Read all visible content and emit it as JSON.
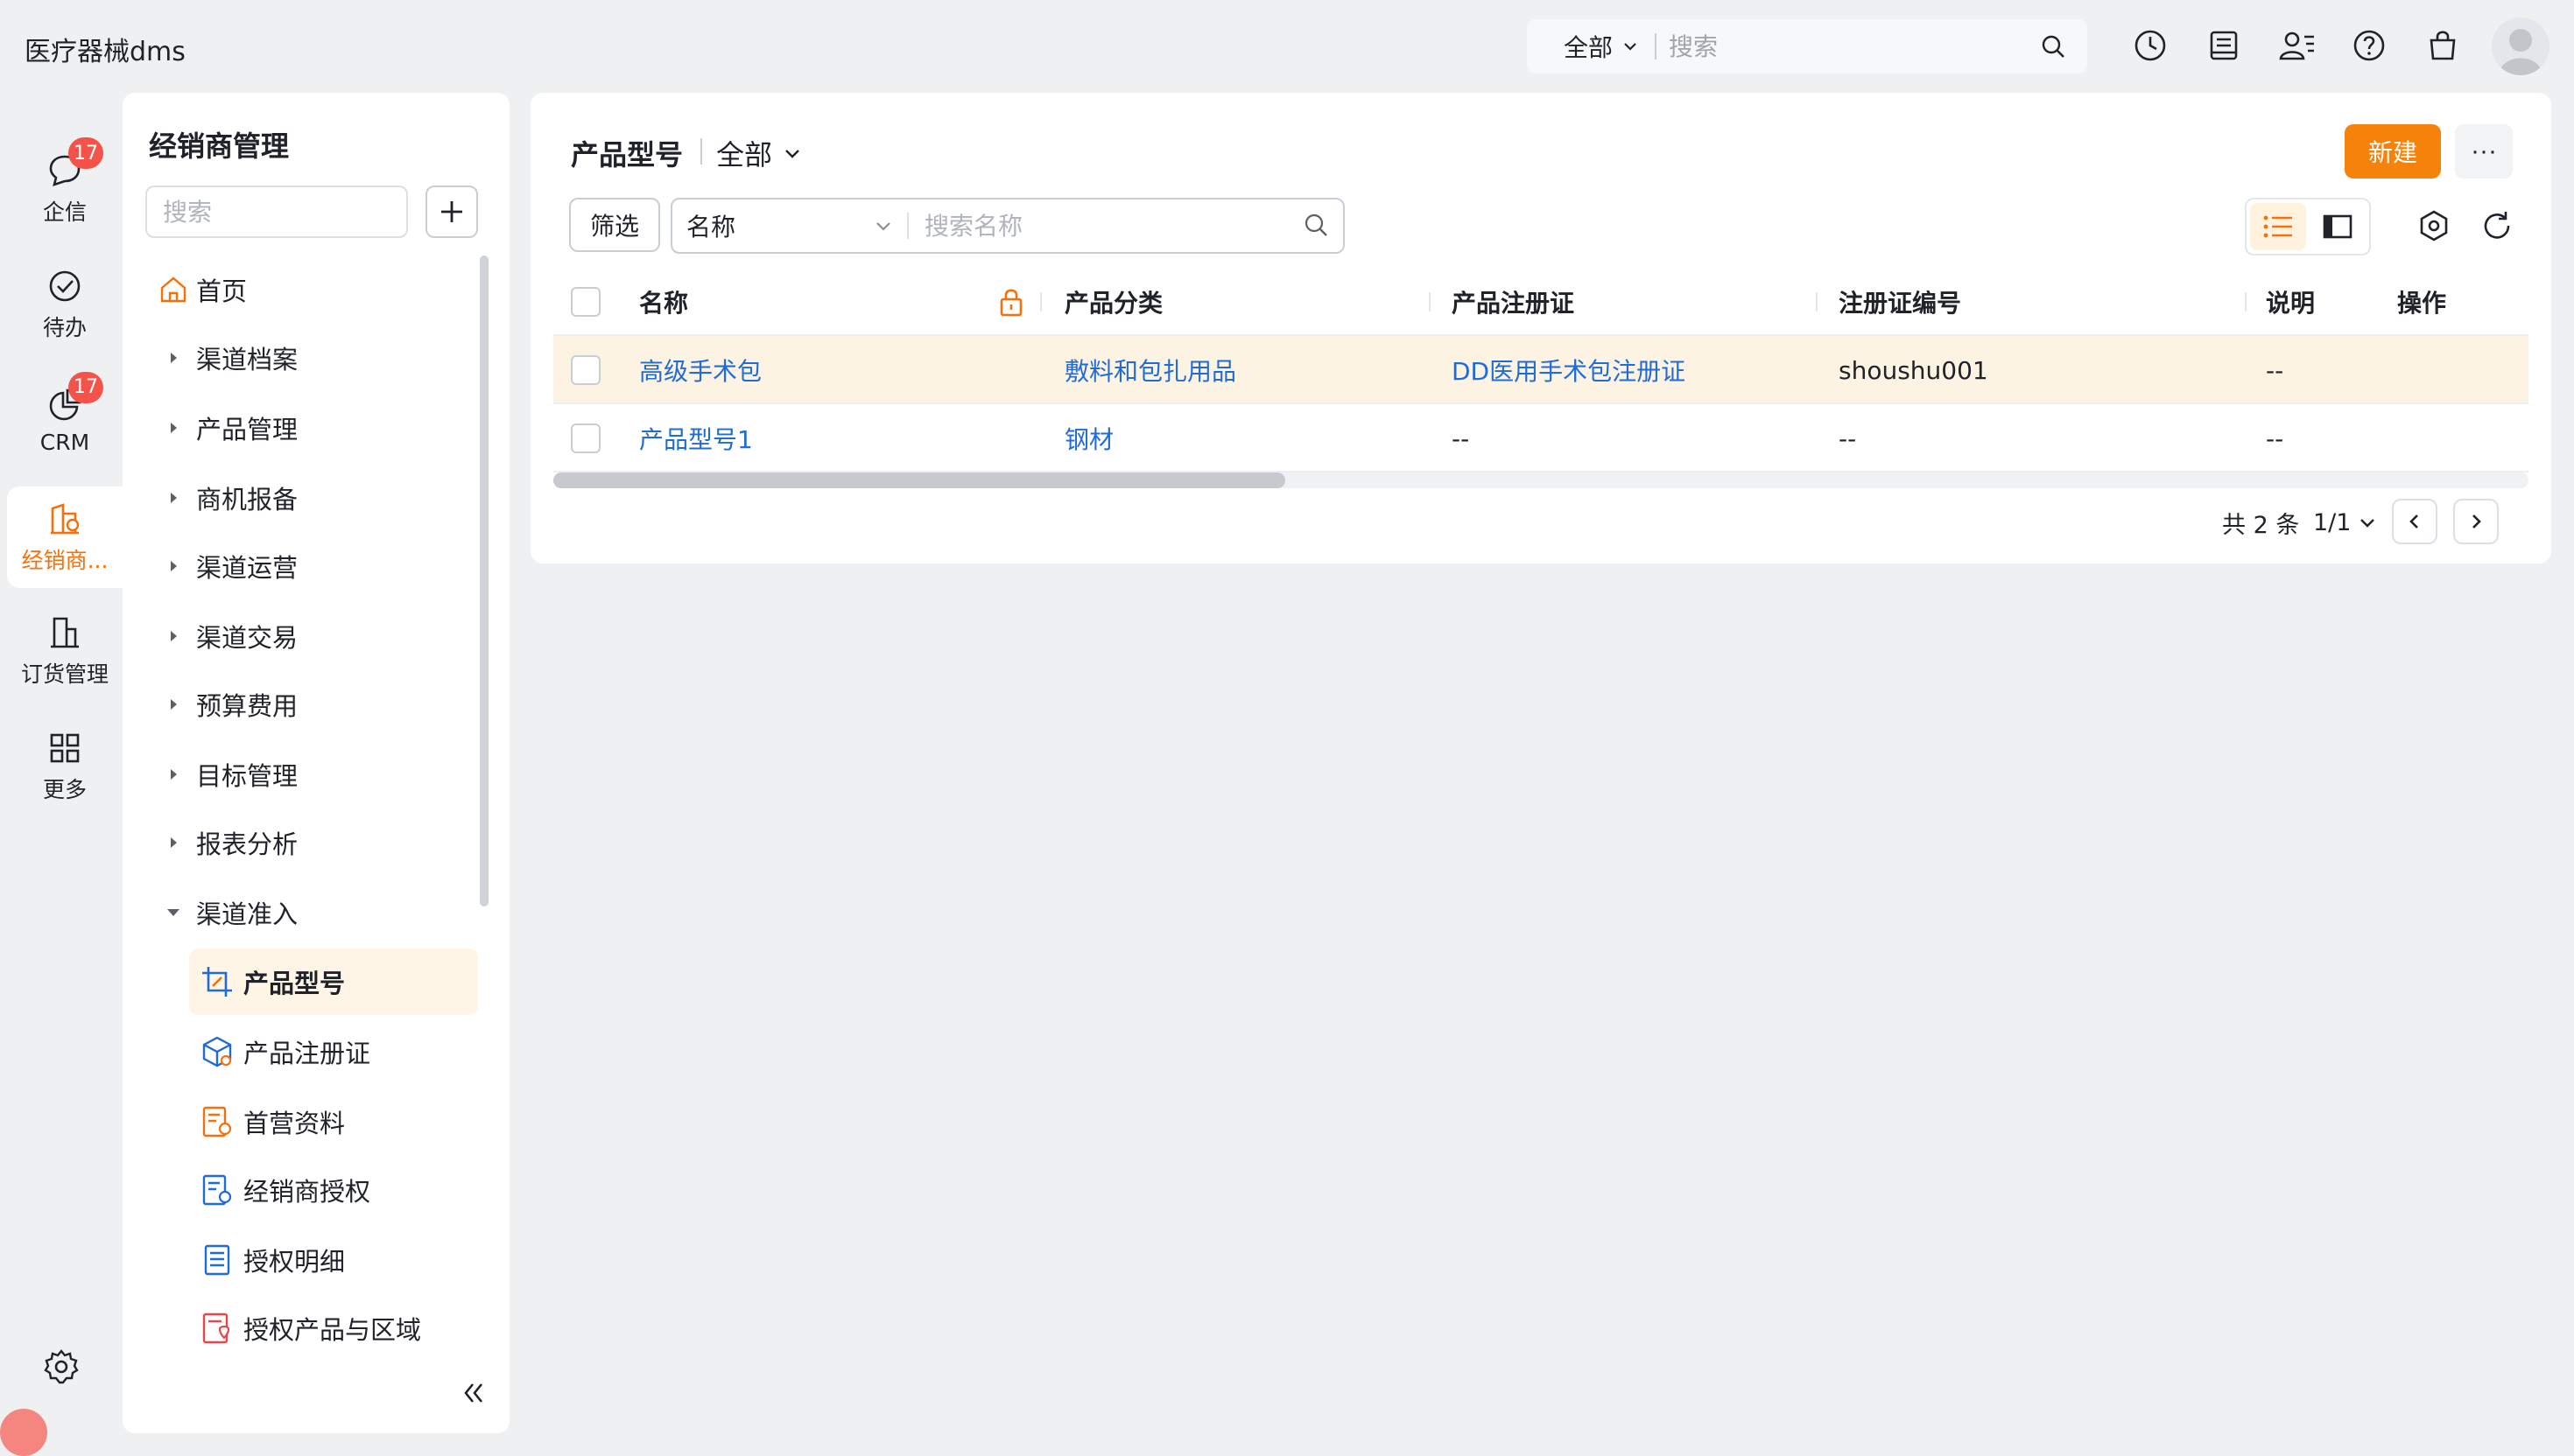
{
  "app": {
    "title": "医疗器械dms"
  },
  "global_search": {
    "scope": "全部",
    "placeholder": "搜索"
  },
  "top_icons": [
    "clock-icon",
    "inbox-icon",
    "contacts-icon",
    "help-icon",
    "bag-icon"
  ],
  "rail": {
    "items": [
      {
        "label": "企信",
        "icon": "chat-icon",
        "badge": "17"
      },
      {
        "label": "待办",
        "icon": "check-circle-icon"
      },
      {
        "label": "CRM",
        "icon": "pie-icon",
        "badge": "17"
      },
      {
        "label": "经销商...",
        "icon": "dealer-icon",
        "active": true
      },
      {
        "label": "订货管理",
        "icon": "building-icon"
      },
      {
        "label": "更多",
        "icon": "grid-icon"
      }
    ]
  },
  "panel": {
    "title": "经销商管理",
    "search_placeholder": "搜索",
    "nav": [
      {
        "label": "首页",
        "icon": "home-icon"
      },
      {
        "label": "渠道档案"
      },
      {
        "label": "产品管理"
      },
      {
        "label": "商机报备"
      },
      {
        "label": "渠道运营"
      },
      {
        "label": "渠道交易"
      },
      {
        "label": "预算费用"
      },
      {
        "label": "目标管理"
      },
      {
        "label": "报表分析"
      },
      {
        "label": "渠道准入",
        "expanded": true
      }
    ],
    "sub_nav": [
      {
        "label": "产品型号",
        "active": true
      },
      {
        "label": "产品注册证"
      },
      {
        "label": "首营资料"
      },
      {
        "label": "经销商授权"
      },
      {
        "label": "授权明细"
      },
      {
        "label": "授权产品与区域"
      }
    ]
  },
  "main": {
    "title": "产品型号",
    "scope": "全部",
    "new_label": "新建",
    "more_label": "···",
    "filter_label": "筛选",
    "field_label": "名称",
    "search_placeholder": "搜索名称",
    "columns": [
      "名称",
      "产品分类",
      "产品注册证",
      "注册证编号",
      "说明",
      "操作"
    ],
    "rows": [
      {
        "name": "高级手术包",
        "category": "敷料和包扎用品",
        "certificate": "DD医用手术包注册证",
        "cert_no": "shoushu001",
        "note": "--",
        "highlight": true
      },
      {
        "name": "产品型号1",
        "category": "钢材",
        "certificate": "--",
        "cert_no": "--",
        "note": "--"
      }
    ],
    "pagination": {
      "total": "共 2 条",
      "page": "1/1"
    }
  },
  "colors": {
    "accent": "#f5820a",
    "link": "#1f6bd8",
    "badge": "#f5524a"
  }
}
